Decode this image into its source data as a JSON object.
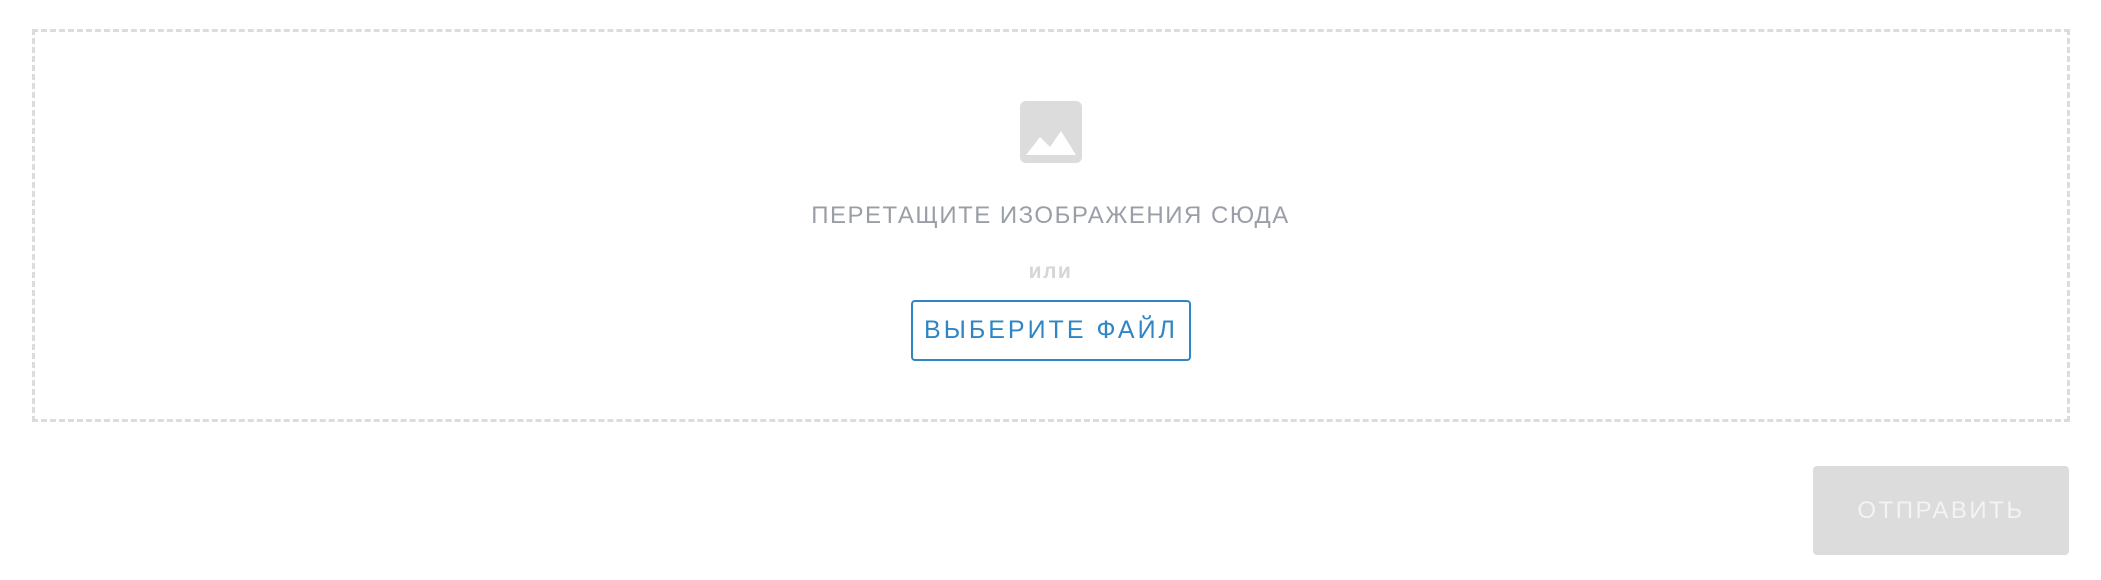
{
  "upload": {
    "icon": "image-icon",
    "drop_title": "ПЕРЕТАЩИТЕ ИЗОБРАЖЕНИЯ СЮДА",
    "or_text": "или",
    "choose_label": "ВЫБЕРИТЕ ФАЙЛ"
  },
  "form": {
    "submit_label": "ОТПРАВИТЬ",
    "submit_disabled": true
  },
  "colors": {
    "accent": "#2f86c6",
    "muted_text": "#9a9ea6",
    "border": "#dcdcdc",
    "disabled_bg": "#dcdcdc"
  }
}
